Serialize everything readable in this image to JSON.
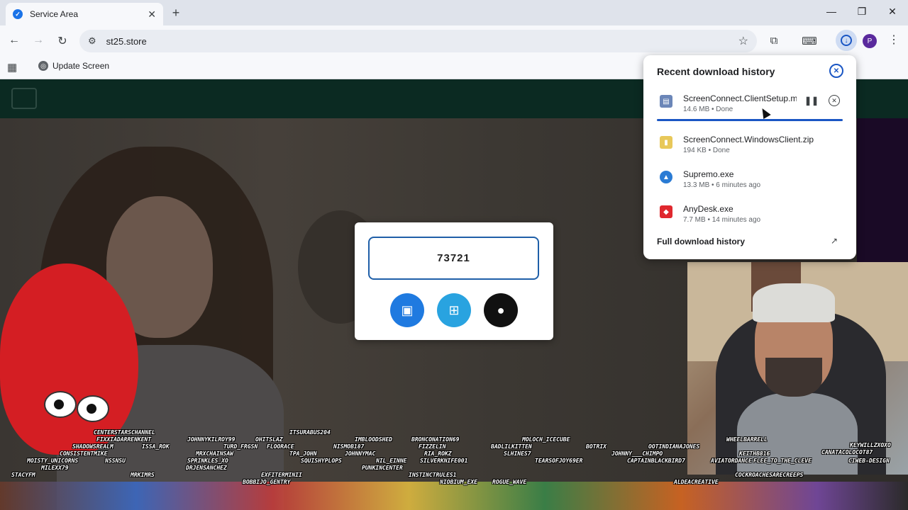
{
  "browser": {
    "tab_title": "Service Area",
    "url": "st25.store",
    "bookmark_label": "Update Screen",
    "profile_initial": "P"
  },
  "page": {
    "code": "73721",
    "os_buttons": [
      "android",
      "windows",
      "apple"
    ]
  },
  "downloads": {
    "header": "Recent download history",
    "items": [
      {
        "name": "ScreenConnect.ClientSetup.msi",
        "meta": "14.6 MB • Done",
        "icon": "installer-icon",
        "progress": 1.0
      },
      {
        "name": "ScreenConnect.WindowsClient.zip",
        "meta": "194 KB • Done",
        "icon": "zip-folder-icon"
      },
      {
        "name": "Supremo.exe",
        "meta": "13.3 MB • 6 minutes ago",
        "icon": "supremo-icon"
      },
      {
        "name": "AnyDesk.exe",
        "meta": "7.7 MB • 14 minutes ago",
        "icon": "anydesk-icon"
      }
    ],
    "footer": "Full download history"
  },
  "stream": {
    "chatters": [
      "CENTERSTARSCHANNEL",
      "FIXXIADARRENKENT",
      "SHADOWSREALM",
      "ISSA_ROK",
      "CONSISTENTMIKE",
      "MOISTY_UNICORNS",
      "NSSNSU",
      "MILEXX79",
      "STACYFM",
      "MRKIMRS",
      "JOHNNYKILROY99",
      "OHITSLAZ",
      "TURD_FRGSN",
      "FLOORACE",
      "MRXCHAINSAW",
      "SPRINKLES_XO",
      "DRJENSANCHEZ",
      "ITSURABUS204",
      "TPA_JOHN",
      "SQUISHYPLOPS",
      "IMBLOODSHED",
      "NISMOB187",
      "JOHNNYMAC",
      "NIL_EINNE",
      "PUNKINCENTER",
      "BRONCONATION69",
      "FIZZELIN",
      "RIA_ROKZ",
      "SILVERKNIFE001",
      "INSTINCTRULES1",
      "NIOBIUM_EXE",
      "EXFITERMINII",
      "BOBBIJO_GENTRY",
      "MOLOCH_ICECUBE",
      "BADLILKITTEN",
      "SLHINES7",
      "TEARSOFJOY69ER",
      "ROGUE_WAVE",
      "BOTRIX",
      "JOHNNY___CHIMPO",
      "CAPTAINBLACKBIRD7",
      "OOTINDIANAJONES",
      "WHEELBARRELL",
      "KEITHB816",
      "AVIATORDANCE",
      "FLEE_TO_THE_CLEVE",
      "ALDEACREATIVE",
      "COCKROACHESARECREEPS",
      "KEYWILLZXOXO",
      "CANATACOLOCOT87",
      "CIWEB-DESIGN"
    ]
  }
}
